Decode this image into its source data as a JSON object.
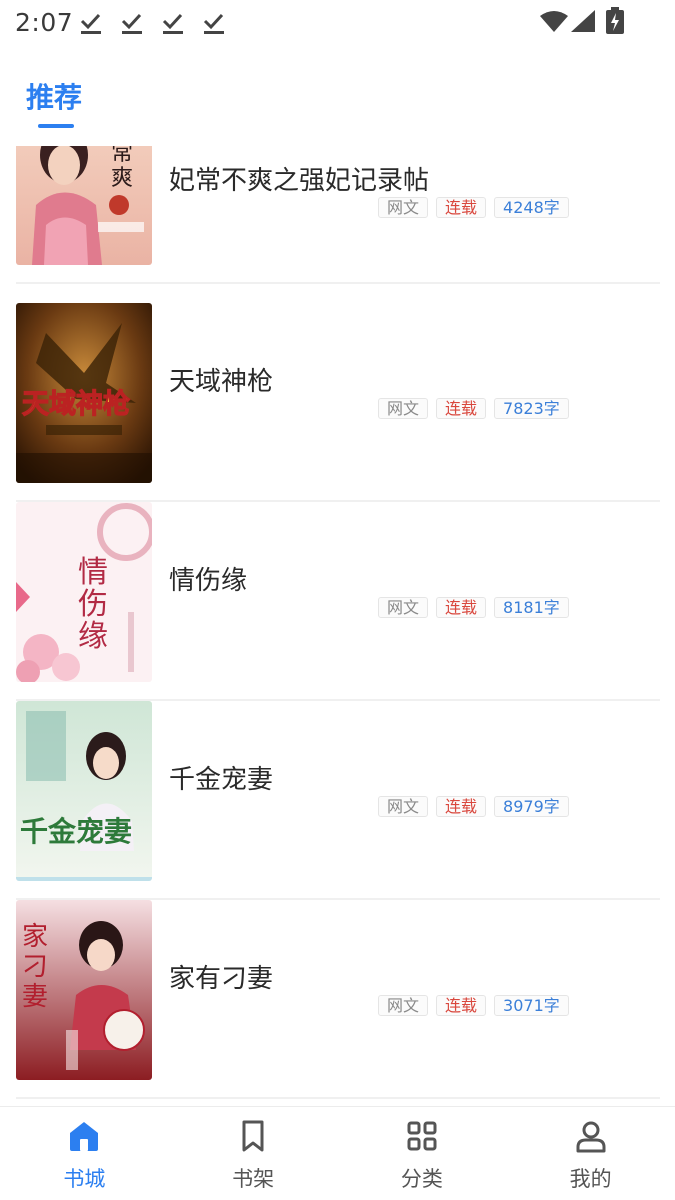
{
  "status_bar": {
    "time": "2:07",
    "icons": [
      "download-done-icon",
      "download-done-icon",
      "download-done-icon",
      "download-done-icon",
      "wifi-icon",
      "signal-icon",
      "battery-charging-icon"
    ]
  },
  "tabs": [
    {
      "label": "推荐",
      "active": true
    }
  ],
  "books": [
    {
      "title": "妃常不爽之强妃记录帖",
      "tags": [
        "网文",
        "连载",
        "4248字"
      ],
      "cover_lettering": "妃常不爽之"
    },
    {
      "title": "天域神枪",
      "tags": [
        "网文",
        "连载",
        "7823字"
      ],
      "cover_lettering": "天域神枪"
    },
    {
      "title": "情伤缘",
      "tags": [
        "网文",
        "连载",
        "8181字"
      ],
      "cover_lettering": "情伤缘"
    },
    {
      "title": "千金宠妻",
      "tags": [
        "网文",
        "连载",
        "8979字"
      ],
      "cover_lettering": "千金宠妻"
    },
    {
      "title": "家有刁妻",
      "tags": [
        "网文",
        "连载",
        "3071字"
      ],
      "cover_lettering": "家有刁妻"
    }
  ],
  "bottom_nav": [
    {
      "label": "书城",
      "icon": "home-icon",
      "active": true
    },
    {
      "label": "书架",
      "icon": "bookmark-icon",
      "active": false
    },
    {
      "label": "分类",
      "icon": "category-grid-icon",
      "active": false
    },
    {
      "label": "我的",
      "icon": "person-icon",
      "active": false
    }
  ],
  "colors": {
    "accent": "#2c7ff0",
    "tag_red": "#d9473d",
    "tag_blue": "#3b7fd8",
    "tag_gray": "#8a8a8a"
  }
}
